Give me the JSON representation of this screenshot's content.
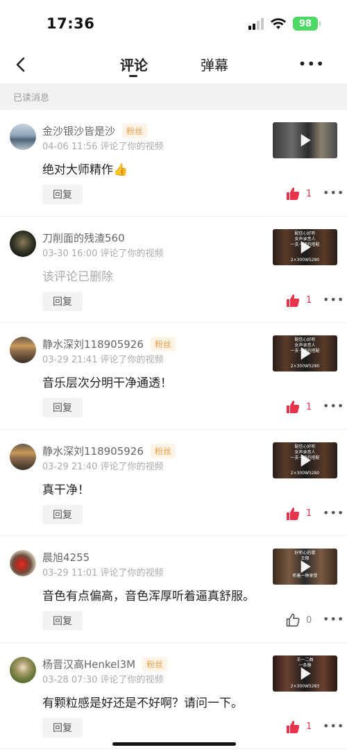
{
  "status_bar": {
    "time": "17:36",
    "battery": "98"
  },
  "nav": {
    "tabs": [
      {
        "label": "评论",
        "active": true
      },
      {
        "label": "弹幕",
        "active": false
      }
    ]
  },
  "section": {
    "label": "已读消息"
  },
  "actions": {
    "reply_label": "回复"
  },
  "comments": [
    {
      "username": "金沙银沙皆是沙",
      "badge": "粉丝",
      "time": "04-06 11:56",
      "action": "评论了你的视频",
      "text": "绝对大师精作👍",
      "deleted": false,
      "likes": "1",
      "liked": true
    },
    {
      "username": "刀削面的残渣560",
      "badge": "",
      "time": "03-30 16:00",
      "action": "评论了你的视频",
      "text": "该评论已删除",
      "deleted": true,
      "likes": "1",
      "liked": true
    },
    {
      "username": "静水深刘118905926",
      "badge": "粉丝",
      "time": "03-29 21:41",
      "action": "评论了你的视频",
      "text": "音乐层次分明干净通透！",
      "deleted": false,
      "likes": "1",
      "liked": true
    },
    {
      "username": "静水深刘118905926",
      "badge": "粉丝",
      "time": "03-29 21:40",
      "action": "评论了你的视频",
      "text": "真干净！",
      "deleted": false,
      "likes": "1",
      "liked": true
    },
    {
      "username": "晨旭4255",
      "badge": "",
      "time": "03-29 11:01",
      "action": "评论了你的视频",
      "text": "音色有点偏高，音色浑厚听着逼真舒服。",
      "deleted": false,
      "likes": "0",
      "liked": false
    },
    {
      "username": "杨晋汉高Henkel3M",
      "badge": "粉丝",
      "time": "03-28 07:30",
      "action": "评论了你的视频",
      "text": "有颗粒感是好还是不好啊？请问一下。",
      "deleted": false,
      "likes": "1",
      "liked": true
    }
  ],
  "thumbnail_captions": [
    [],
    [
      "配信心好听",
      "女声录音人",
      "一支一把的搭配",
      "2×300W5280"
    ],
    [
      "配信心好听",
      "女声录音人",
      "一支一把的搭配",
      "2×300W5280"
    ],
    [
      "配信心好听",
      "女声录音人",
      "一支一把的搭配",
      "2×300W5280"
    ],
    [
      "好听心的歌",
      "王郁",
      "听着一种享受"
    ],
    [
      "王一二曲",
      "一条路",
      "2×300W5283"
    ]
  ],
  "colors": {
    "like_red": "#e8334a",
    "fan_badge": "#e8a04a",
    "battery_green": "#4cd964"
  }
}
